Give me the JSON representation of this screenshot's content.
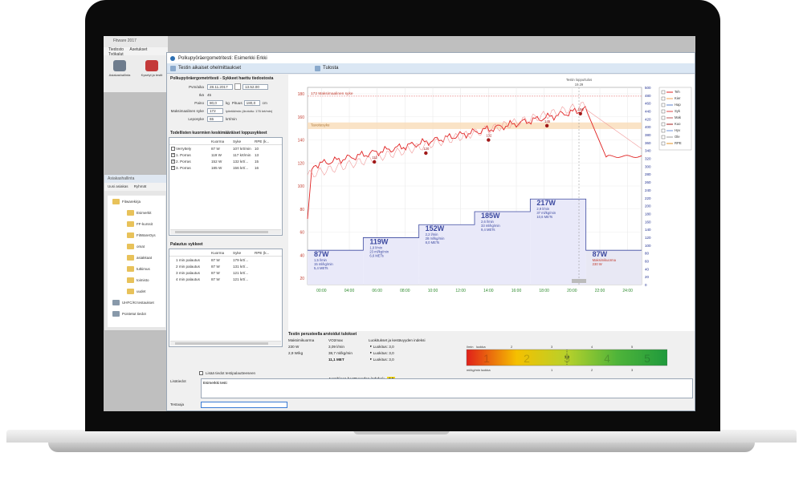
{
  "background_app": {
    "title": "Fitware 2017",
    "menu": [
      "Tiedosto",
      "Asetukset",
      "Työkalut"
    ],
    "toolbar": [
      "Asiakashallinta",
      "Kyselyt ja testit"
    ],
    "panel_title": "Asiakashallinta",
    "panel_toolbar": [
      "Uusi asiakas",
      "Ryhmät"
    ],
    "tree": [
      "Fitwarekirja",
      "Esimerkit",
      "FF-kurssit",
      "FitWareOys",
      "omat",
      "asiakkaat",
      "tutkimus",
      "toimisto",
      "uudet",
      "UHFC/Kt testaukset",
      "Poistetut tiedot"
    ]
  },
  "window": {
    "title": "Polkupyöräergometritesti: Esimerkki Erkki",
    "toolbar": {
      "results_label": "Testin aikaiset ohelmittaukset",
      "print_label": "Tulosta"
    }
  },
  "form": {
    "section_title": "Polkupyöräergometritesti - Sykkeet haettu tiedostosta",
    "date_label": "Pvm/aika",
    "date_value": "28.11.2017",
    "time_value": "13.52.00",
    "age_label": "Ikä",
    "age_value": "45",
    "weight_label": "Paino",
    "weight_value": "80,0",
    "weight_unit": "kg",
    "height_label": "Pituus",
    "height_value": "180,0",
    "height_unit": "cm",
    "maxhr_label": "Maksimaalinen syke",
    "maxhr_value": "172",
    "maxhr_note": "lyöntiä/min (Arvioitu: 176 krt/min)",
    "resthr_label": "Leposyke",
    "resthr_value": "65",
    "resthr_unit": "krt/min"
  },
  "loads": {
    "title": "Todellisten kuormien keskimääräiset loppusykkeet",
    "headers": [
      "Kuorma",
      "Syke",
      "RPE (k..."
    ],
    "rows": [
      {
        "name": "Verryttely",
        "checked": false,
        "load": "87 W",
        "hr": "107 krt/min",
        "rpe": "10"
      },
      {
        "name": "1. Porras",
        "checked": true,
        "load": "119 W",
        "hr": "117 krt/min",
        "rpe": "13"
      },
      {
        "name": "2. Porras",
        "checked": true,
        "load": "152 W",
        "hr": "132 krt/...",
        "rpe": "15"
      },
      {
        "name": "3. Porras",
        "checked": true,
        "load": "185 W",
        "hr": "156 krt/...",
        "rpe": "16"
      }
    ]
  },
  "recovery": {
    "title": "Palautus sykkeet",
    "headers": [
      "Kuorma",
      "Syke",
      "RPE (k..."
    ],
    "rows": [
      {
        "name": "1 min palautus",
        "load": "87 W",
        "hr": "179 krt/..."
      },
      {
        "name": "2 min palautus",
        "load": "87 W",
        "hr": "131 krt/..."
      },
      {
        "name": "3 min palautus",
        "load": "87 W",
        "hr": "121 krt/..."
      },
      {
        "name": "4 min palautus",
        "load": "87 W",
        "hr": "121 krt/..."
      }
    ]
  },
  "bottom": {
    "checkbox_label": "Lisää tiedot testipalautteeseen",
    "notes_label": "Lisätiedot",
    "notes_value": "Esimerkki testi",
    "comment_label": "Testaaja"
  },
  "results": {
    "title": "Testin perusteella arvioidut tulokset",
    "headers": [
      "Maksimikuorma",
      "VO2max",
      "Luokitukset ja kestävyyden indeksi"
    ],
    "col1": [
      "230 W",
      "2,9 W/kg"
    ],
    "col2": [
      "3,09 l/min",
      "38,7 ml/kg/min",
      "11,1 MET"
    ],
    "col3": [
      "Luokitus: 3,0",
      "Luokitus: 3,0",
      "Luokitus: 3,0"
    ],
    "index_label": "Aerobisen kestävyyden indeksi:",
    "index_value": "3,0",
    "scale_top_left": "l/min",
    "scale_top_left2": "luokka",
    "scale_top_marks": [
      "2",
      "3",
      "4",
      "5"
    ],
    "scale_numbers": [
      "1",
      "2",
      "3",
      "4",
      "5"
    ],
    "scale_bottom_left": "ml/kg/min",
    "scale_bottom_left2": "luokka",
    "scale_bottom_marks": [
      "1",
      "2",
      "3"
    ],
    "scale_value": 3.0,
    "colors": [
      "#e0201a",
      "#f5c000",
      "#b7d12b",
      "#4fb43a",
      "#1f9a3c"
    ]
  },
  "chart_data": {
    "type": "line",
    "title": "",
    "annotation_max": "Testin loppu/tulos",
    "annotation_max_time": "19.29",
    "hr_max_label": "172 Maksimaalinen syke",
    "band_label": "Tavoitesyke",
    "x_ticks": [
      "00:00",
      "04:00",
      "06:00",
      "08:00",
      "10:00",
      "12:00",
      "14:00",
      "16:00",
      "18:00",
      "20:00",
      "22:00",
      "24:00"
    ],
    "y_left_ticks": [
      "180",
      "160",
      "140",
      "120",
      "100",
      "80",
      "60",
      "40",
      "20"
    ],
    "y_right_ticks": [
      "500",
      "480",
      "460",
      "440",
      "420",
      "400",
      "380",
      "360",
      "340",
      "320",
      "300",
      "280",
      "260",
      "240",
      "220",
      "200",
      "180",
      "160",
      "140",
      "120",
      "100",
      "80",
      "60",
      "40",
      "20",
      "0"
    ],
    "legend": [
      "Teh",
      "Kier",
      "Hap",
      "Syk",
      "Mak",
      "Kuo",
      "Hyv",
      "Ole",
      "RPE"
    ],
    "steps": [
      {
        "label": "87W",
        "sub": [
          "1,5 l/min",
          "15 ml/kg/min",
          "5,4 METs"
        ],
        "start": 0,
        "end": 4,
        "watts": 87
      },
      {
        "label": "119W",
        "sub": [
          "1,9 l/min",
          "23 ml/kg/min",
          "6,6 METs"
        ],
        "start": 4,
        "end": 8,
        "watts": 119
      },
      {
        "label": "152W",
        "sub": [
          "2,2 l/min",
          "28 ml/kg/min",
          "8,0 METs"
        ],
        "start": 8,
        "end": 12,
        "watts": 152
      },
      {
        "label": "185W",
        "sub": [
          "2,6 l/min",
          "33 ml/kg/min",
          "9,4 METs"
        ],
        "start": 12,
        "end": 16,
        "watts": 185
      },
      {
        "label": "217W",
        "sub": [
          "2,9 l/min",
          "37 ml/kg/min",
          "10,6 METs"
        ],
        "start": 16,
        "end": 20,
        "watts": 217
      },
      {
        "label": "87W",
        "sub": [
          "Maksimikuorma",
          "230 W"
        ],
        "start": 20,
        "end": 24,
        "watts": 87
      }
    ],
    "hr_points": [
      {
        "t": 4.8,
        "hr": 112,
        "label": "112"
      },
      {
        "t": 8.5,
        "hr": 120,
        "label": "120"
      },
      {
        "t": 13,
        "hr": 132,
        "label": "132"
      },
      {
        "t": 17.2,
        "hr": 145,
        "label": "145"
      },
      {
        "t": 19.6,
        "hr": 156,
        "label": "156"
      }
    ],
    "ylim_left": [
      0,
      180
    ],
    "xlim_minutes": [
      0,
      24
    ]
  }
}
